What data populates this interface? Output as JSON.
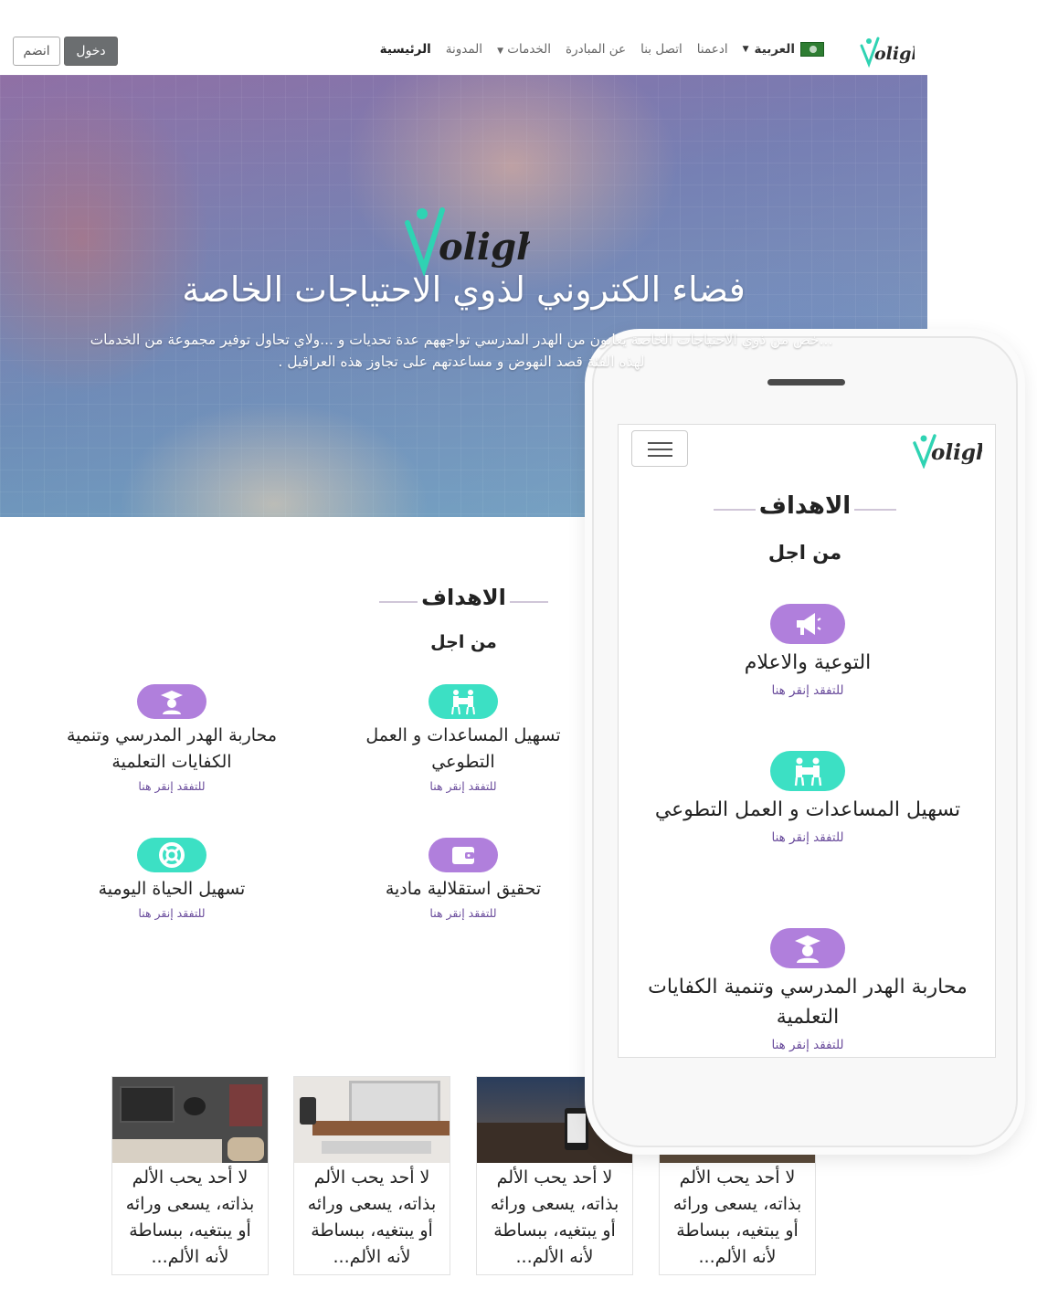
{
  "nav": {
    "join": "انضم",
    "login": "دخول",
    "links": [
      {
        "label": "الرئيسية",
        "active": true
      },
      {
        "label": "المدونة"
      },
      {
        "label": "الخدمات",
        "dropdown": true
      },
      {
        "label": "عن المبادرة"
      },
      {
        "label": "اتصل بنا"
      },
      {
        "label": "ادعمنا"
      }
    ],
    "language": "العربية",
    "logo_icon": "volight-logo"
  },
  "hero": {
    "title": "فضاء الكتروني لذوي الاحتياجات الخاصة",
    "text": "...خص من ذوي الاحتياجات الخاصة يعانون من الهدر المدرسي تواجههم عدة تحديات و ...ولاي تحاول توفير مجموعة من الخدمات لهذه الفئة قصد النهوض و مساعدتهم على تجاوز هذه العراقيل ."
  },
  "goals": {
    "title": "الاهداف",
    "subtitle": "من اجل",
    "link_text": "للتفقد إنقر هنا",
    "items": [
      {
        "icon": "graduation-icon",
        "color": "#b07fdc",
        "text": "محاربة الهدر المدرسي وتنمية الكفايات التعلمية"
      },
      {
        "icon": "helping-hands-icon",
        "color": "#3ce0c4",
        "text": "تسهيل المساعدات و العمل التطوعي"
      },
      {
        "icon": "lifebuoy-icon",
        "color": "#3ce0c4",
        "text": "تسهيل الحياة اليومية"
      },
      {
        "icon": "wallet-icon",
        "color": "#b07fdc",
        "text": "تحقيق استقلالية مادية"
      }
    ]
  },
  "cards": [
    {
      "text": "لا أحد يحب الألم بذاته، يسعى ورائه أو يبتغيه، ببساطة لأنه الألم..."
    },
    {
      "text": "لا أحد يحب الألم بذاته، يسعى ورائه أو يبتغيه، ببساطة لأنه الألم..."
    },
    {
      "text": "لا أحد يحب الألم بذاته، يسعى ورائه أو يبتغيه، ببساطة لأنه الألم..."
    },
    {
      "text": "لا أحد يحب الألم بذاته، يسعى ورائه أو يبتغيه، ببساطة لأنه الألم..."
    }
  ],
  "mobile": {
    "title": "الاهداف",
    "subtitle": "من اجل",
    "link_text": "للتفقد إنقر هنا",
    "items": [
      {
        "icon": "megaphone-icon",
        "color": "#b07fdc",
        "text": "التوعية والاعلام"
      },
      {
        "icon": "helping-hands-icon",
        "color": "#3ce0c4",
        "text": "تسهيل المساعدات و العمل التطوعي"
      },
      {
        "icon": "graduation-icon",
        "color": "#b07fdc",
        "text": "محاربة الهدر المدرسي وتنمية الكفايات التعلمية"
      }
    ]
  }
}
